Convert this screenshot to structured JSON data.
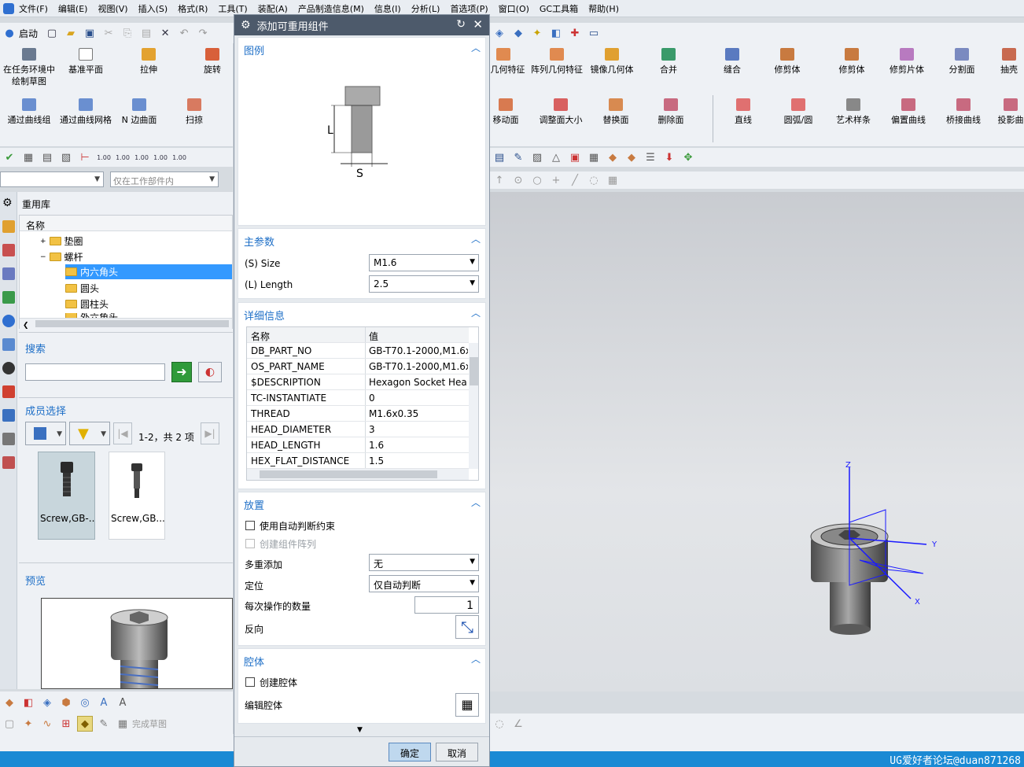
{
  "menu": [
    "文件(F)",
    "编辑(E)",
    "视图(V)",
    "插入(S)",
    "格式(R)",
    "工具(T)",
    "装配(A)",
    "产品制造信息(M)",
    "信息(I)",
    "分析(L)",
    "首选项(P)",
    "窗口(O)",
    "GC工具箱",
    "帮助(H)"
  ],
  "toolbar": {
    "start_label": "启动"
  },
  "ribbon_left_row1": [
    "在任务环境中绘制草图",
    "基准平面",
    "拉伸",
    "旋转"
  ],
  "ribbon_left_row2": [
    "通过曲线组",
    "通过曲线网格",
    "N 边曲面",
    "扫掠"
  ],
  "ribbon_right_row1": [
    "取几何特征",
    "阵列几何特征",
    "镜像几何体",
    "合并",
    "缝合",
    "修剪体",
    "修剪体",
    "修剪片体",
    "分割面",
    "抽壳"
  ],
  "ribbon_right_row2": [
    "移动面",
    "调整面大小",
    "替换面",
    "删除面",
    "直线",
    "圆弧/圆",
    "艺术样条",
    "偏置曲线",
    "桥接曲线",
    "投影曲"
  ],
  "filter": {
    "scope_placeholder": "仅在工作部件内"
  },
  "reuse_library": {
    "title": "重用库",
    "column": "名称",
    "tree": [
      "垫圈",
      "螺杆",
      "内六角头",
      "圆头",
      "圆柱头",
      "外六角头"
    ]
  },
  "search": {
    "title": "搜索"
  },
  "member_select": {
    "title": "成员选择",
    "pager": "1-2，共 2 项",
    "items": [
      "Screw,GB-...",
      "Screw,GB..."
    ]
  },
  "preview": {
    "title": "预览"
  },
  "dialog": {
    "title": "添加可重用组件",
    "legend_title": "图例",
    "legend_L": "L",
    "legend_S": "S",
    "main_params_title": "主参数",
    "size_label": "(S) Size",
    "size_value": "M1.6",
    "length_label": "(L) Length",
    "length_value": "2.5",
    "details_title": "详细信息",
    "details_col_name": "名称",
    "details_col_value": "值",
    "details_rows": [
      {
        "name": "DB_PART_NO",
        "value": "GB-T70.1-2000,M1.6x"
      },
      {
        "name": "OS_PART_NAME",
        "value": "GB-T70.1-2000,M1.6x"
      },
      {
        "name": "$DESCRIPTION",
        "value": "Hexagon Socket Hea"
      },
      {
        "name": "TC-INSTANTIATE",
        "value": "0"
      },
      {
        "name": "THREAD",
        "value": "M1.6x0.35"
      },
      {
        "name": "HEAD_DIAMETER",
        "value": "3"
      },
      {
        "name": "HEAD_LENGTH",
        "value": "1.6"
      },
      {
        "name": "HEX_FLAT_DISTANCE",
        "value": "1.5"
      }
    ],
    "placement_title": "放置",
    "auto_constraint": "使用自动判断约束",
    "create_array": "创建组件阵列",
    "multi_add_label": "多重添加",
    "multi_add_value": "无",
    "position_label": "定位",
    "position_value": "仅自动判断",
    "count_label": "每次操作的数量",
    "count_value": "1",
    "reverse_label": "反向",
    "cavity_title": "腔体",
    "create_cavity": "创建腔体",
    "edit_cavity": "编辑腔体",
    "ok": "确定",
    "cancel": "取消"
  },
  "bottom_toolbar": {
    "finish_sketch": "完成草图"
  },
  "axes": {
    "x": "X",
    "y": "Y",
    "z": "Z"
  },
  "watermark": "UG爱好者论坛@duan871268",
  "colors": {
    "accent": "#1e6fc7",
    "titlebar": "#4d5a6b",
    "statusbar": "#1a8ad4",
    "selection": "#3399ff"
  }
}
